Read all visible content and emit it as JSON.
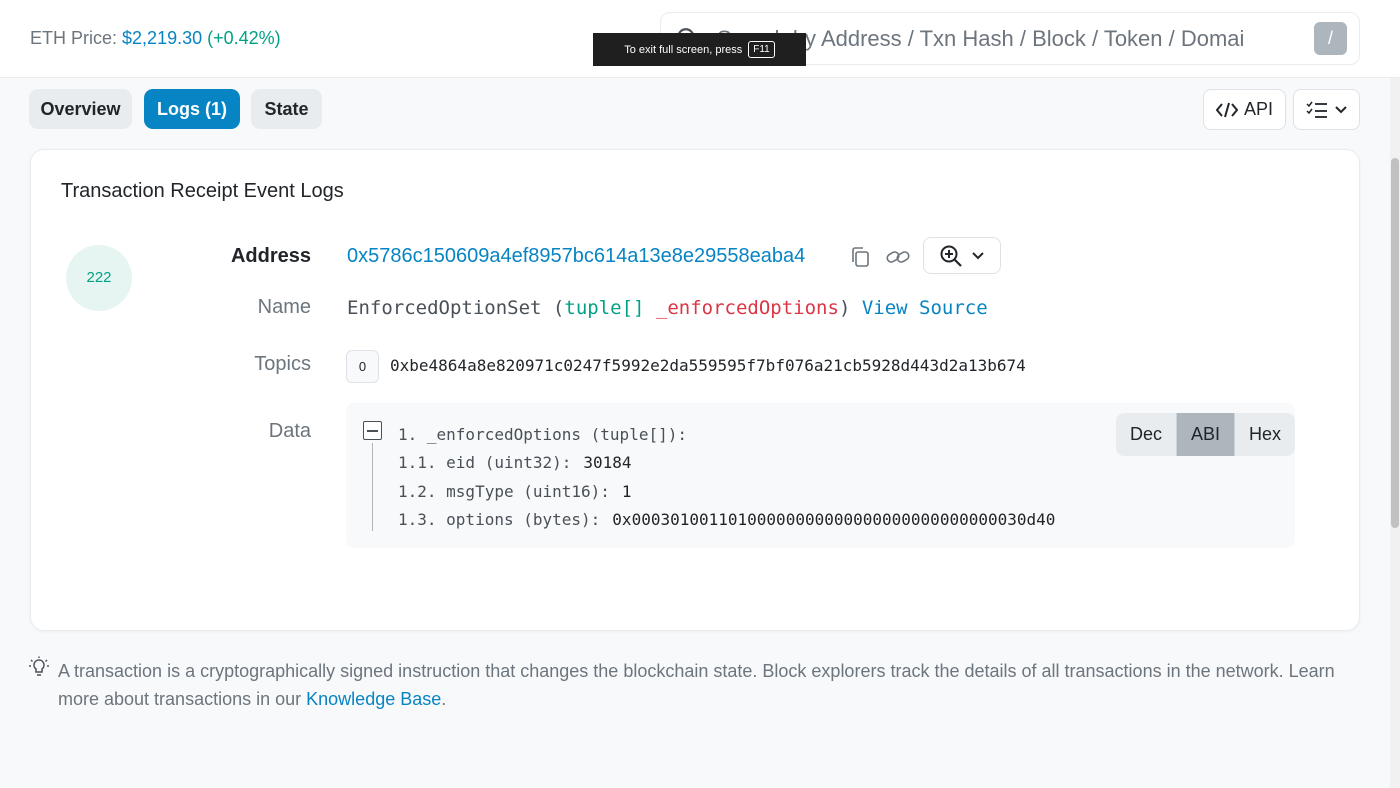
{
  "header": {
    "eth_price_label": "ETH Price:",
    "eth_price_value": "$2,219.30",
    "eth_price_change": "(+0.42%)",
    "search_placeholder": "Search by Address / Txn Hash / Block / Token / Domain Name",
    "search_visible_text": "Search by Address / Txn Hash / Block / Token / Domai",
    "slash_shortcut": "/"
  },
  "toast": {
    "text": "To exit full screen, press",
    "key": "F11"
  },
  "tabs": [
    {
      "label": "Overview",
      "active": false
    },
    {
      "label": "Logs (1)",
      "active": true
    },
    {
      "label": "State",
      "active": false
    }
  ],
  "toolbar": {
    "api_label": "API"
  },
  "card": {
    "title": "Transaction Receipt Event Logs",
    "log_index": "222",
    "address_label": "Address",
    "address_value": "0x5786c150609a4ef8957bc614a13e8e29558eaba4",
    "name_label": "Name",
    "event_name": "EnforcedOptionSet",
    "event_param_type": "tuple[]",
    "event_param_name": "_enforcedOptions",
    "view_source": "View Source",
    "topics_label": "Topics",
    "topics": [
      {
        "index": "0",
        "value": "0xbe4864a8e820971c0247f5992e2da559595f7bf076a21cb5928d443d2a13b674"
      }
    ],
    "data_label": "Data",
    "data_lines": [
      {
        "key": "1. _enforcedOptions (tuple[]):",
        "value": ""
      },
      {
        "key": "1.1. eid (uint32):",
        "value": "30184"
      },
      {
        "key": "1.2. msgType (uint16):",
        "value": "1"
      },
      {
        "key": "1.3. options (bytes):",
        "value": "0x00030100110100000000000000000000000000030d40"
      }
    ],
    "formats": [
      {
        "label": "Dec",
        "active": false
      },
      {
        "label": "ABI",
        "active": true
      },
      {
        "label": "Hex",
        "active": false
      }
    ]
  },
  "footer": {
    "note_text": "A transaction is a cryptographically signed instruction that changes the blockchain state. Block explorers track the details of all transactions in the network. Learn more about transactions in our",
    "link_text": "Knowledge Base",
    "note_end": "."
  },
  "colors": {
    "accent": "#0784c3",
    "positive": "#00a186",
    "argument": "#dc3545"
  }
}
